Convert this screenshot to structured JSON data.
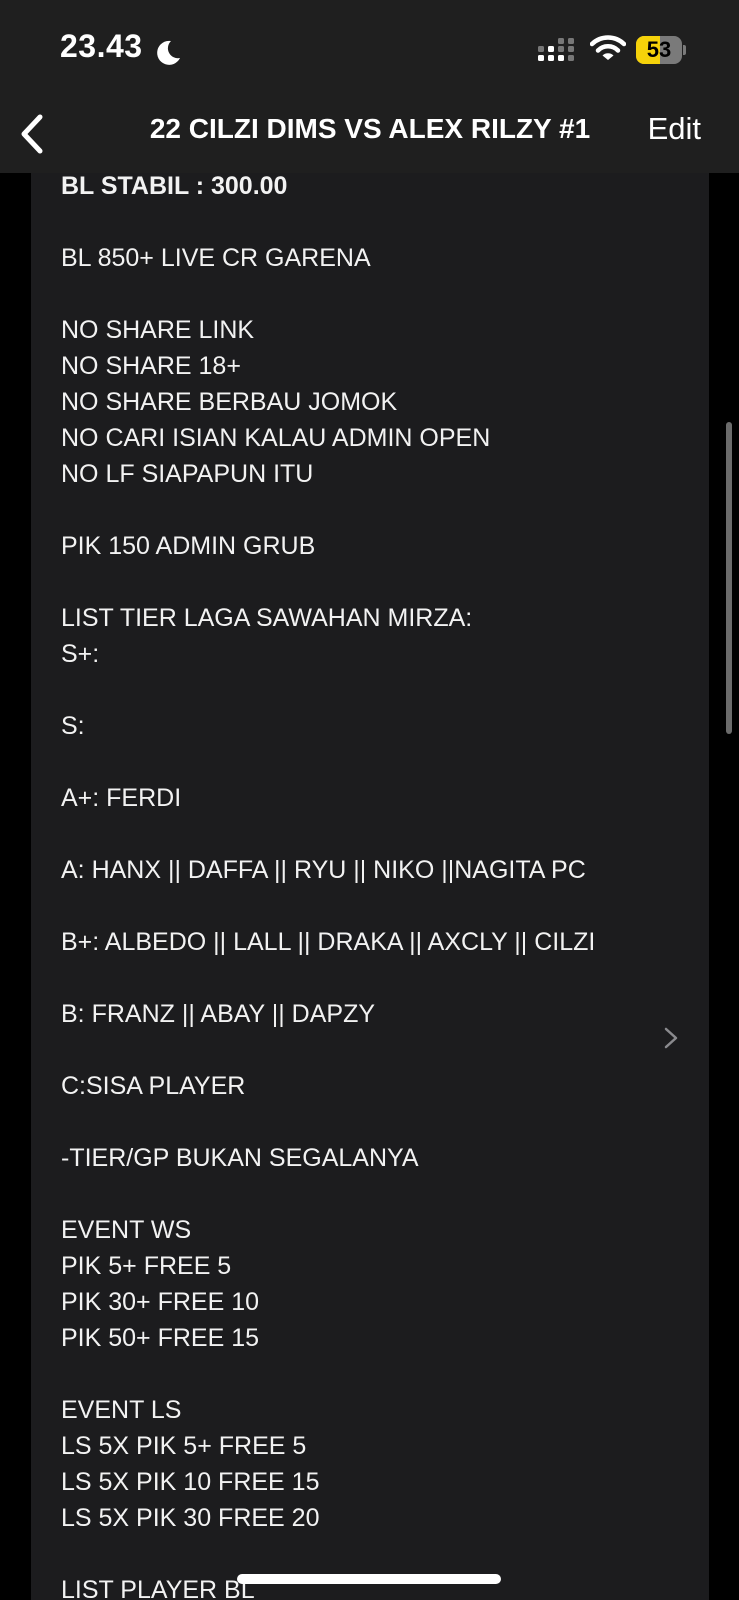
{
  "status_bar": {
    "time": "23.43",
    "battery_level": 53,
    "battery_label": "53",
    "battery_color": "#f5d20a"
  },
  "nav": {
    "back_icon": "chevron-left-icon",
    "title": "22 CILZI DIMS VS ALEX RILZY #1",
    "edit_label": "Edit"
  },
  "note": {
    "lines": [
      "BL STABIL : 300.00",
      "",
      "BL 850+ LIVE CR GARENA",
      "",
      "NO SHARE LINK",
      "NO SHARE 18+",
      "NO SHARE BERBAU JOMOK",
      "NO CARI ISIAN KALAU ADMIN OPEN",
      "NO LF SIAPAPUN ITU",
      "",
      "PIK 150 ADMIN GRUB",
      "",
      "LIST TIER LAGA SAWAHAN MIRZA:",
      "S+:",
      "",
      "S:",
      "",
      "A+: FERDI",
      "",
      "A: HANX || DAFFA || RYU || NIKO ||NAGITA PC",
      "",
      "B+: ALBEDO || LALL || DRAKA || AXCLY || CILZI",
      "",
      "B: FRANZ || ABAY || DAPZY",
      "",
      "C:SISA PLAYER",
      "",
      "-TIER/GP BUKAN SEGALANYA",
      "",
      "EVENT WS",
      "PIK 5+ FREE 5",
      "PIK 30+ FREE 10",
      "PIK 50+ FREE 15",
      "",
      "EVENT LS",
      "LS 5X PIK 5+ FREE 5",
      "LS 5X PIK 10 FREE 15",
      "LS 5X PIK 30 FREE 20",
      "",
      "LIST PLAYER BL"
    ]
  }
}
